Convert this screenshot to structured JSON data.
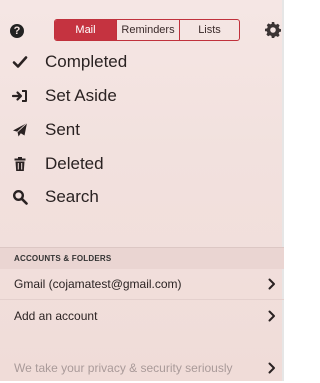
{
  "header": {
    "help_icon_label": "?",
    "tabs": [
      {
        "label": "Mail",
        "active": true
      },
      {
        "label": "Reminders",
        "active": false
      },
      {
        "label": "Lists",
        "active": false
      }
    ]
  },
  "folders": [
    {
      "label": "Completed",
      "icon": "check-icon"
    },
    {
      "label": "Set Aside",
      "icon": "set-aside-icon"
    },
    {
      "label": "Sent",
      "icon": "paper-plane-icon"
    },
    {
      "label": "Deleted",
      "icon": "trash-icon"
    },
    {
      "label": "Search",
      "icon": "search-icon"
    }
  ],
  "accounts": {
    "section_title": "ACCOUNTS & FOLDERS",
    "rows": [
      {
        "label": "Gmail (cojamatest@gmail.com)"
      },
      {
        "label": "Add an account"
      }
    ]
  },
  "footer": {
    "privacy_label": "We take your privacy & security seriously"
  },
  "colors": {
    "accent": "#c53340",
    "background": "#f3e2df"
  }
}
